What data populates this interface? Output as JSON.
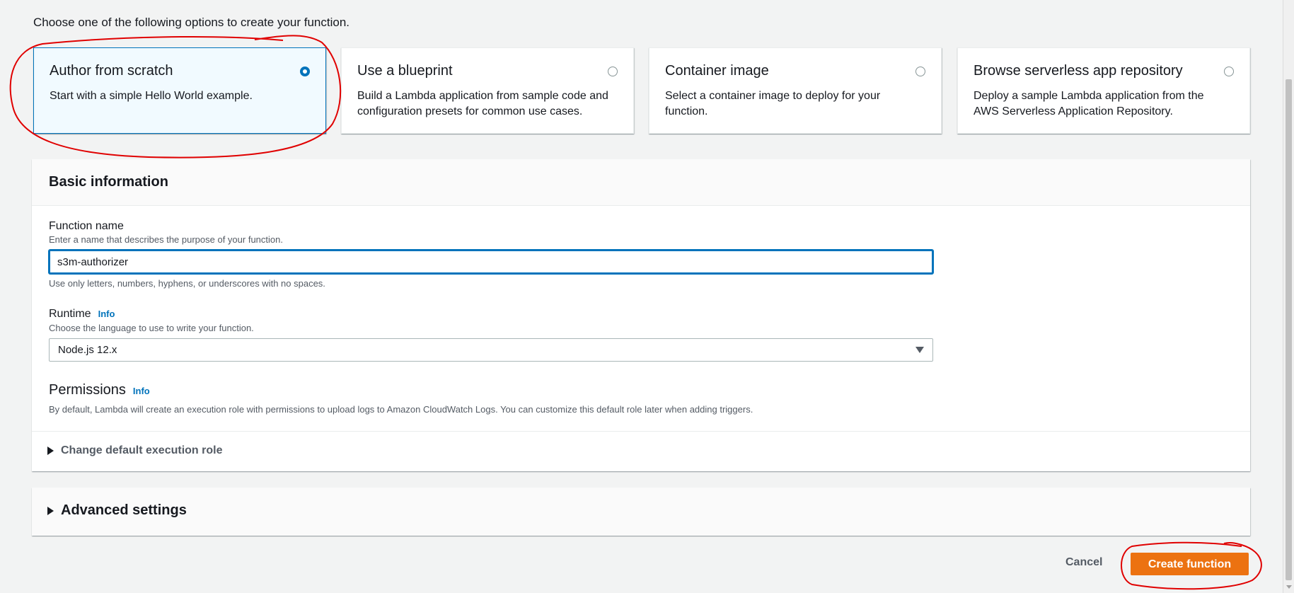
{
  "intro_text": "Choose one of the following options to create your function.",
  "options": [
    {
      "title": "Author from scratch",
      "description": "Start with a simple Hello World example.",
      "selected": true
    },
    {
      "title": "Use a blueprint",
      "description": "Build a Lambda application from sample code and configuration presets for common use cases.",
      "selected": false
    },
    {
      "title": "Container image",
      "description": "Select a container image to deploy for your function.",
      "selected": false
    },
    {
      "title": "Browse serverless app repository",
      "description": "Deploy a sample Lambda application from the AWS Serverless Application Repository.",
      "selected": false
    }
  ],
  "basic_info": {
    "title": "Basic information",
    "function_name": {
      "label": "Function name",
      "description": "Enter a name that describes the purpose of your function.",
      "value": "s3m-authorizer",
      "hint": "Use only letters, numbers, hyphens, or underscores with no spaces."
    },
    "runtime": {
      "label": "Runtime",
      "info": "Info",
      "description": "Choose the language to use to write your function.",
      "value": "Node.js 12.x"
    },
    "permissions": {
      "label": "Permissions",
      "info": "Info",
      "description": "By default, Lambda will create an execution role with permissions to upload logs to Amazon CloudWatch Logs. You can customize this default role later when adding triggers."
    },
    "change_role_label": "Change default execution role"
  },
  "advanced_settings_label": "Advanced settings",
  "actions": {
    "cancel_label": "Cancel",
    "create_label": "Create function"
  },
  "colors": {
    "accent": "#0073bb",
    "primary_button": "#ec7211",
    "annotation": "#e00000"
  }
}
